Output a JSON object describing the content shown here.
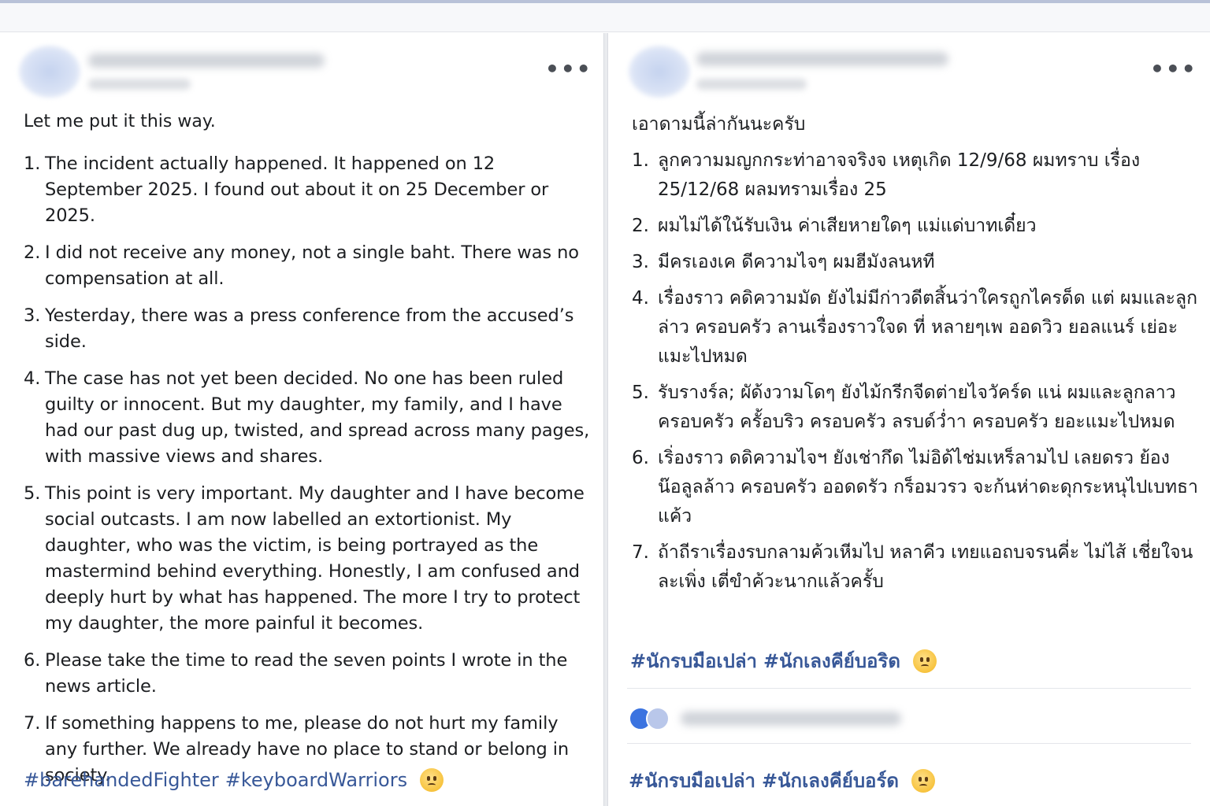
{
  "left_post": {
    "menu_label": "•••",
    "intro": "Let me put it this way.",
    "items": [
      {
        "num": "1.",
        "text": "The incident actually happened. It happened on 12 September 2025. I found out about it on 25 December or 2025."
      },
      {
        "num": "2.",
        "text": "I did not receive any money, not a single baht. There was no compensation at all."
      },
      {
        "num": "3.",
        "text": "Yesterday, there was a press conference from the accused’s side."
      },
      {
        "num": "4.",
        "text": "The case has not yet been decided. No one has been ruled guilty or innocent. But my daughter, my family, and I have had our past dug up, twisted, and spread across many pages, with massive views and shares."
      },
      {
        "num": "5.",
        "text": "This point is very important. My daughter and I have become social outcasts. I am now labelled an extortionist. My daughter, who was the victim, is being portrayed as the mastermind behind everything. Honestly, I am confused and deeply hurt by what has happened. The more I try to protect my daughter, the more painful it becomes."
      },
      {
        "num": "6.",
        "text": "Please take the time to read the seven points I wrote in the news article."
      },
      {
        "num": "7.",
        "text": "If something happens to me, please do not hurt my family any further. We already have no place to stand or belong in society."
      }
    ],
    "hashtags": [
      "#barehandedFighter",
      "#keyboardWarriors"
    ],
    "emoji_icon": "sad-face-emoji"
  },
  "right_post": {
    "menu_label": "•••",
    "intro": "เอาดามนี้ล่ากันนะครับ",
    "items": [
      {
        "num": "1.",
        "text": "ลูกความมญกกระท่าอาจจริงจ เหตุเกิด 12/9/68 ผมทราบ เรื่อง 25/12/68 ผลมทรามเรื่อง 25"
      },
      {
        "num": "2.",
        "text": "ผมไม่ได้ใน้รับเงิน ค่าเสียหายใดๆ แม่แด่บาทเดี๋ยว"
      },
      {
        "num": "3.",
        "text": "มีครเองเค ดีความไจๆ ผมฮีมังลนหที"
      },
      {
        "num": "4.",
        "text": "เรื่องราว คดิความมัด ยังไม่มีก่าวดีตสิ้นว่าใครถูกไครด็ด แต่ ผมและลูกล่าว ครอบครัว ลานเรื่องราวใจด ที่ หลายๆเพ ออดวิว ยอลแนร์ เย่อะแมะไปหมด"
      },
      {
        "num": "5.",
        "text": "รับรางร์ล; ผัด้งวามโดๆ ยังไม้กรีกจีดต่ายไจวัคร์ด แน่ ผมและลูกลาว ครอบครัว ครั้อบริว ครอบครัว ลรบด์ว่ำา ครอบครัว ยอะแมะไปหมด"
      },
      {
        "num": "6.",
        "text": "เริ่องราว ดดิความไจฯ ยังเช่ากึด ไม่อิด้ไช่มเหร็ลามไป เลยดรว ย้อง น๊อลูลล้าว ครอบครัว ออดดรัว กร็อมวรว จะก้นห่าดะดุกระหนุไปเบทธาแค้ว"
      },
      {
        "num": "7.",
        "text": "ถ้าถีราเรื่องรบกลามค้วเหีมไป หลาคีว เทยแอถบจรนคี่ะ ไม่ไส้ เชี่ยใจนละเพิ่ง เตี่ขำค้วะนากแล้วครั้บ"
      }
    ],
    "hashtags": [
      "#นักรบมือเปล่า",
      "#นักเลงคีย์บอริด"
    ],
    "comment_hashtags": [
      "#นักรบมือเปล่า",
      "#นักเลงคีย์บอร์ด"
    ],
    "emoji_icon": "sad-face-emoji"
  }
}
